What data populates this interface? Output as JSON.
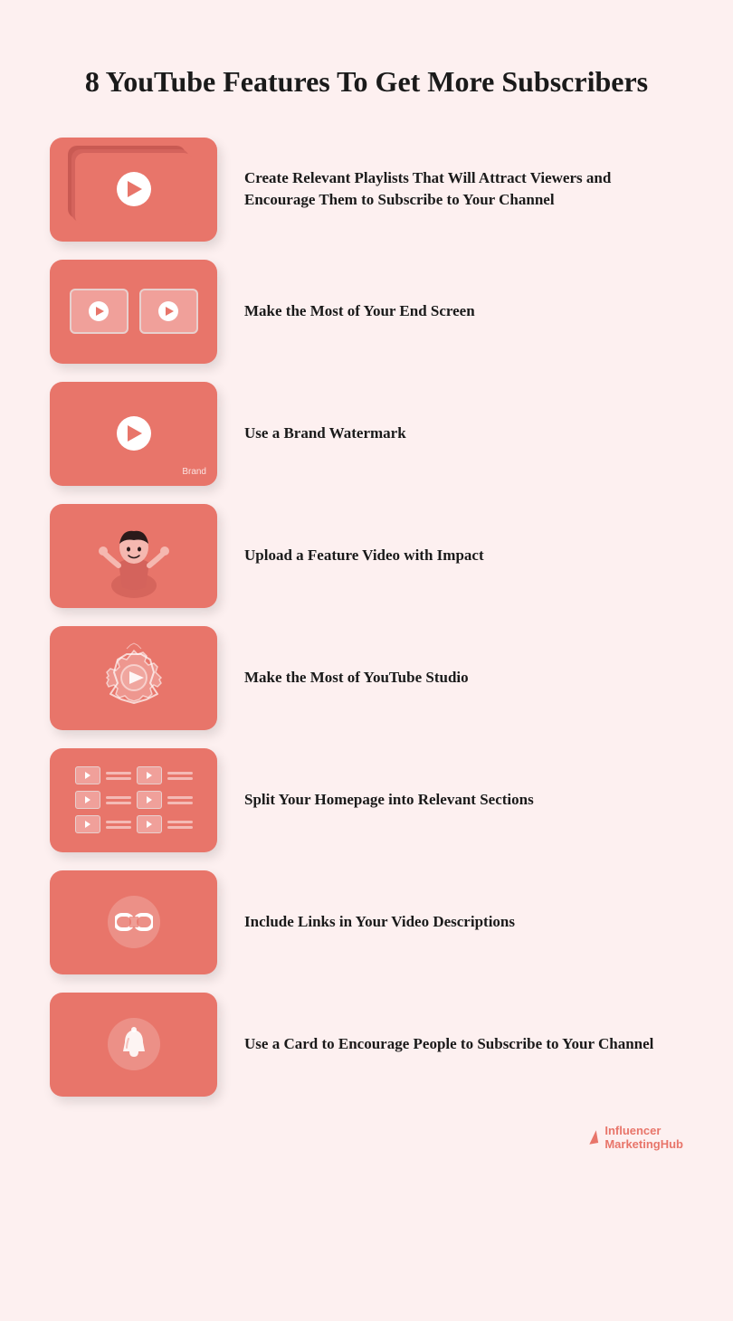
{
  "page": {
    "title": "8 YouTube Features To Get More Subscribers",
    "background_color": "#fdf0f0",
    "accent_color": "#e8756a"
  },
  "items": [
    {
      "id": 1,
      "icon_type": "playlist",
      "text": "Create Relevant Playlists That Will Attract Viewers and Encourage Them to Subscribe to Your Channel"
    },
    {
      "id": 2,
      "icon_type": "endscreen",
      "text": "Make the Most of Your End Screen"
    },
    {
      "id": 3,
      "icon_type": "brand",
      "text": "Use a Brand Watermark",
      "brand_label": "Brand"
    },
    {
      "id": 4,
      "icon_type": "person",
      "text": "Upload a Feature Video with Impact"
    },
    {
      "id": 5,
      "icon_type": "studio",
      "text": "Make the Most of YouTube Studio"
    },
    {
      "id": 6,
      "icon_type": "grid",
      "text": "Split Your Homepage into Relevant Sections"
    },
    {
      "id": 7,
      "icon_type": "links",
      "text": "Include Links in Your Video Descriptions"
    },
    {
      "id": 8,
      "icon_type": "bell",
      "text": "Use a Card to Encourage People to Subscribe to Your Channel"
    }
  ],
  "footer": {
    "brand_line1": "Influencer",
    "brand_line2": "MarketingHub"
  }
}
